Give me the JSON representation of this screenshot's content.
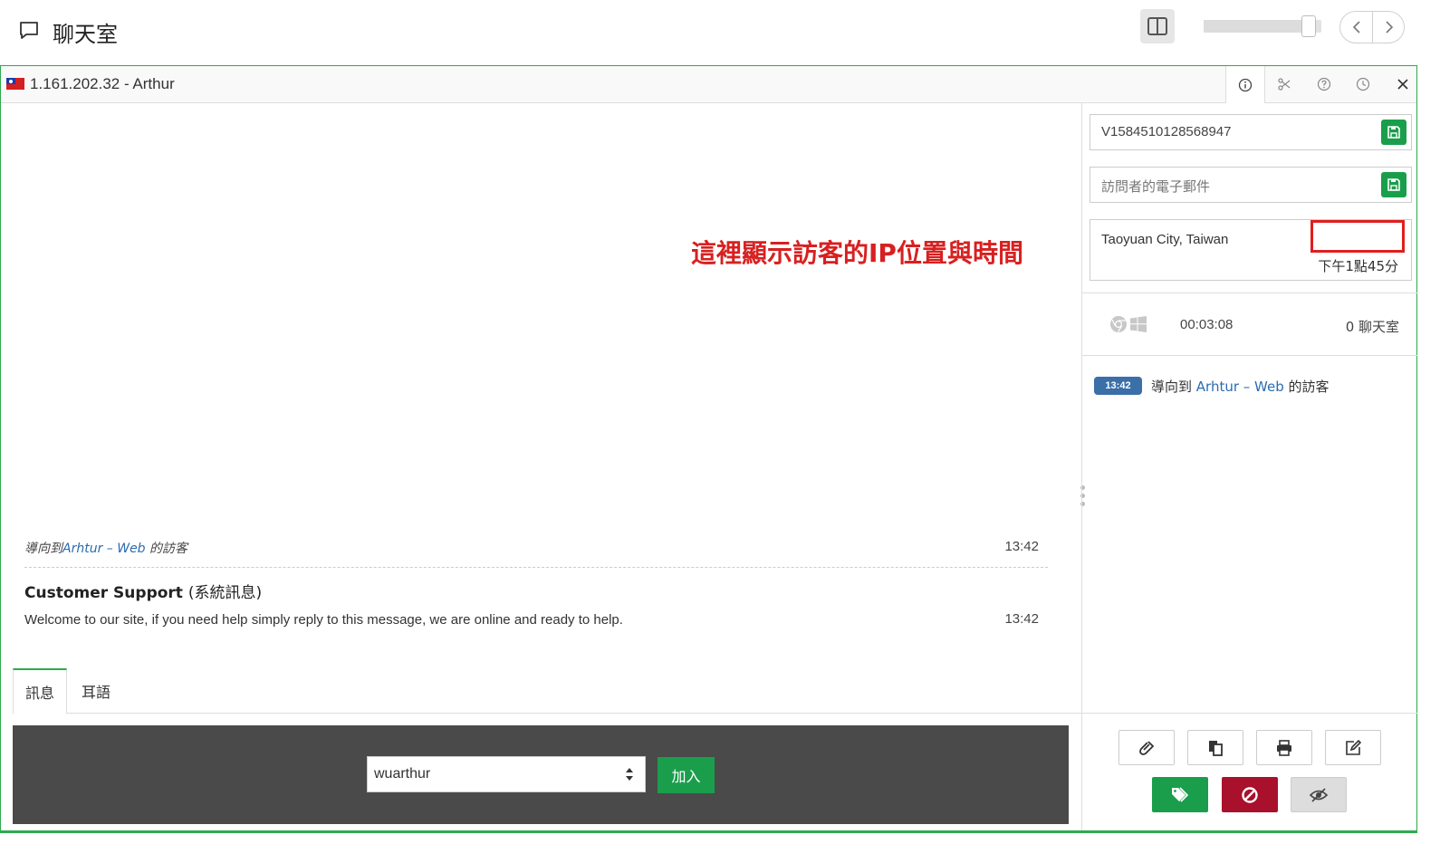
{
  "header": {
    "title": "聊天室",
    "icons": {
      "chat": "chat-bubble-icon",
      "layout": "split-layout-icon",
      "prev": "chevron-left-icon",
      "next": "chevron-right-icon"
    },
    "zoom_slider_fraction": 0.95
  },
  "chat_tab": {
    "flag": "taiwan-flag-icon",
    "title": "1.161.202.32 - Arthur",
    "tab_icons": [
      "info-icon",
      "scissors-icon",
      "question-icon",
      "clock-icon",
      "close-icon"
    ]
  },
  "annotation": "這裡顯示訪客的IP位置與時間",
  "messages": [
    {
      "prefix": "導向到",
      "link": "Arhtur – Web",
      "suffix": " 的訪客",
      "time": "13:42"
    },
    {
      "author": "Customer Support",
      "author_note": "(系統訊息)",
      "body": "Welcome to our site, if you need help simply reply to this message, we are online and ready to help.",
      "time": "13:42"
    }
  ],
  "compose_tabs": [
    "訊息",
    "耳語"
  ],
  "join": {
    "operator": "wuarthur",
    "button": "加入"
  },
  "visitor": {
    "id": "V1584510128568947",
    "email_placeholder": "訪問者的電子郵件",
    "location": "Taoyuan City, Taiwan",
    "local_time": "下午1點45分",
    "duration": "00:03:08",
    "chat_count": "0 聊天室",
    "browser_icons": [
      "chrome-icon",
      "windows-icon"
    ]
  },
  "events": [
    {
      "time": "13:42",
      "prefix": "導向到 ",
      "link": "Arhtur – Web",
      "suffix": " 的訪客"
    }
  ],
  "actions": [
    "attach-icon",
    "copy-icon",
    "print-icon",
    "edit-icon",
    "tag-icon",
    "block-icon",
    "hide-icon"
  ],
  "colors": {
    "accent": "#2eaa4e",
    "button_green": "#1a9e4b",
    "danger": "#a8102c",
    "link": "#2b6cb0",
    "annotation": "#d82020",
    "badge": "#3a6fa8"
  }
}
